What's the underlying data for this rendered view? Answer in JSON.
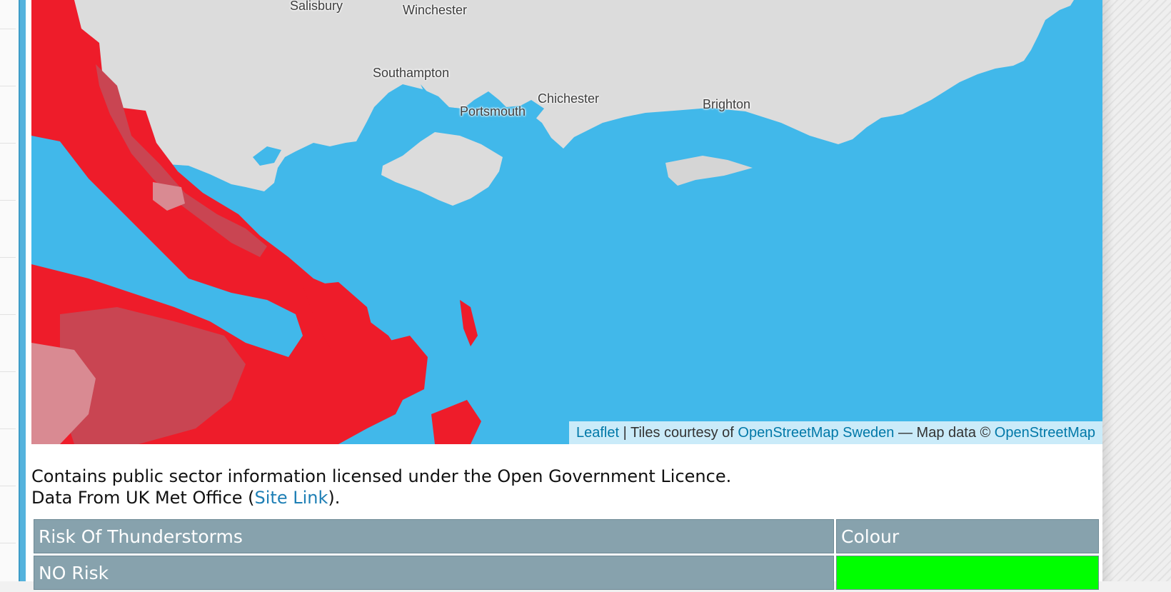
{
  "map": {
    "places": [
      {
        "name": "Salisbury"
      },
      {
        "name": "Winchester"
      },
      {
        "name": "Southampton"
      },
      {
        "name": "Chichester"
      },
      {
        "name": "Portsmouth"
      },
      {
        "name": "Brighton"
      }
    ],
    "attribution": {
      "leaflet": "Leaflet",
      "sep": " | Tiles courtesy of ",
      "tiles_link": "OpenStreetMap Sweden",
      "data_text": " — Map data © ",
      "data_link": "OpenStreetMap"
    },
    "colors": {
      "sea": "#41b8ea",
      "land": "#dcdcdc",
      "risk_high": "#ee1c2a",
      "risk_med": "#c94552",
      "risk_low": "#d98a92"
    }
  },
  "license": {
    "line1": "Contains public sector information licensed under the Open Government Licence.",
    "line2_prefix": "Data From UK Met Office (",
    "link": "Site Link",
    "line2_suffix": ")."
  },
  "table": {
    "headers": [
      "Risk Of Thunderstorms",
      "Colour"
    ],
    "rows": [
      {
        "label": "NO Risk",
        "color": "#00ff00"
      }
    ]
  }
}
